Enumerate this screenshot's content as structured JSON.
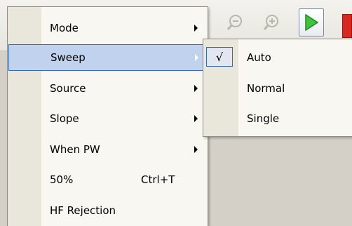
{
  "main_menu": {
    "items": [
      {
        "label": "Mode",
        "shortcut": "",
        "has_submenu": true,
        "selected": false
      },
      {
        "label": "Sweep",
        "shortcut": "",
        "has_submenu": true,
        "selected": true
      },
      {
        "label": "Source",
        "shortcut": "",
        "has_submenu": true,
        "selected": false
      },
      {
        "label": "Slope",
        "shortcut": "",
        "has_submenu": true,
        "selected": false
      },
      {
        "label": "When PW",
        "shortcut": "",
        "has_submenu": true,
        "selected": false
      },
      {
        "label": "50%",
        "shortcut": "Ctrl+T",
        "has_submenu": false,
        "selected": false
      },
      {
        "label": "HF Rejection",
        "shortcut": "",
        "has_submenu": false,
        "selected": false
      }
    ]
  },
  "sweep_submenu": {
    "check_mark": "√",
    "items": [
      {
        "label": "Auto",
        "checked": true
      },
      {
        "label": "Normal",
        "checked": false
      },
      {
        "label": "Single",
        "checked": false
      }
    ]
  },
  "toolbar": {
    "icons": [
      "zoom-out-icon",
      "zoom-in-icon",
      "play-icon",
      "stop-icon"
    ]
  },
  "colors": {
    "menu_bg": "#f8f7f2",
    "gutter": "#e9e6dc",
    "highlight": "#c1d2ee",
    "highlight_border": "#316ac5",
    "play_green": "#2fb52f",
    "stop_red": "#d8281f"
  }
}
